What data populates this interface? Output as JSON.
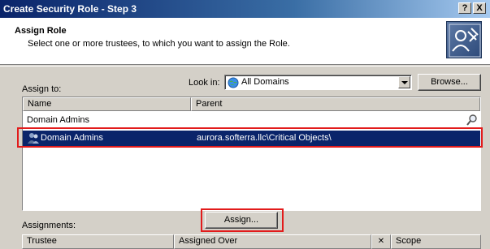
{
  "window": {
    "title": "Create Security Role - Step 3",
    "help_btn": "?",
    "close_btn": "X"
  },
  "header": {
    "title": "Assign Role",
    "subtitle": "Select one or more trustees, to which you want to assign the Role."
  },
  "assign_to": {
    "label": "Assign to:",
    "look_in_label": "Look in:",
    "look_in_value": "All Domains",
    "browse_button": "Browse...",
    "columns": [
      "Name",
      "Parent"
    ],
    "filter_value": "Domain Admins",
    "rows": [
      {
        "name": "Domain Admins",
        "parent": "aurora.softerra.llc\\Critical Objects\\"
      }
    ]
  },
  "assign_button": "Assign...",
  "assignments": {
    "label": "Assignments:",
    "columns": [
      "Trustee",
      "Assigned Over",
      "Scope"
    ],
    "clear_icon_glyph": "✕"
  },
  "colors": {
    "title_bar": "#0a246a",
    "selection": "#0a246a",
    "highlight_box": "#e21b1b",
    "dialog_bg": "#d4d0c8"
  }
}
